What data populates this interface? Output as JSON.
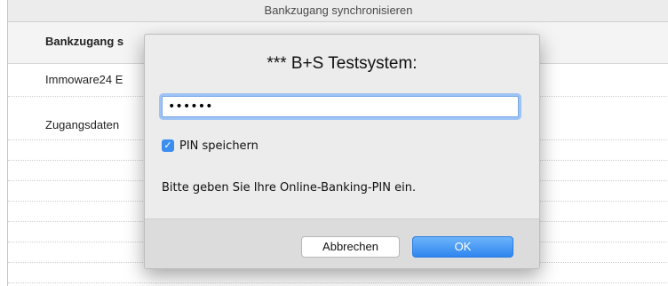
{
  "window": {
    "title": "Bankzugang synchronisieren"
  },
  "table": {
    "header_visible": "Bankzugang s",
    "rows": [
      {
        "text": "Immoware24 E"
      },
      {
        "text": "Zugangsdaten"
      }
    ]
  },
  "dialog": {
    "title": "*** B+S Testsystem:",
    "pin_value": "••••••",
    "save_pin_label": "PIN speichern",
    "save_pin_checked": true,
    "message": "Bitte geben Sie Ihre Online-Banking-PIN ein.",
    "cancel_label": "Abbrechen",
    "ok_label": "OK"
  },
  "colors": {
    "accent": "#3b8ef0",
    "ok_button": "#2f86f0",
    "focus_ring": "#9ec3f5"
  }
}
